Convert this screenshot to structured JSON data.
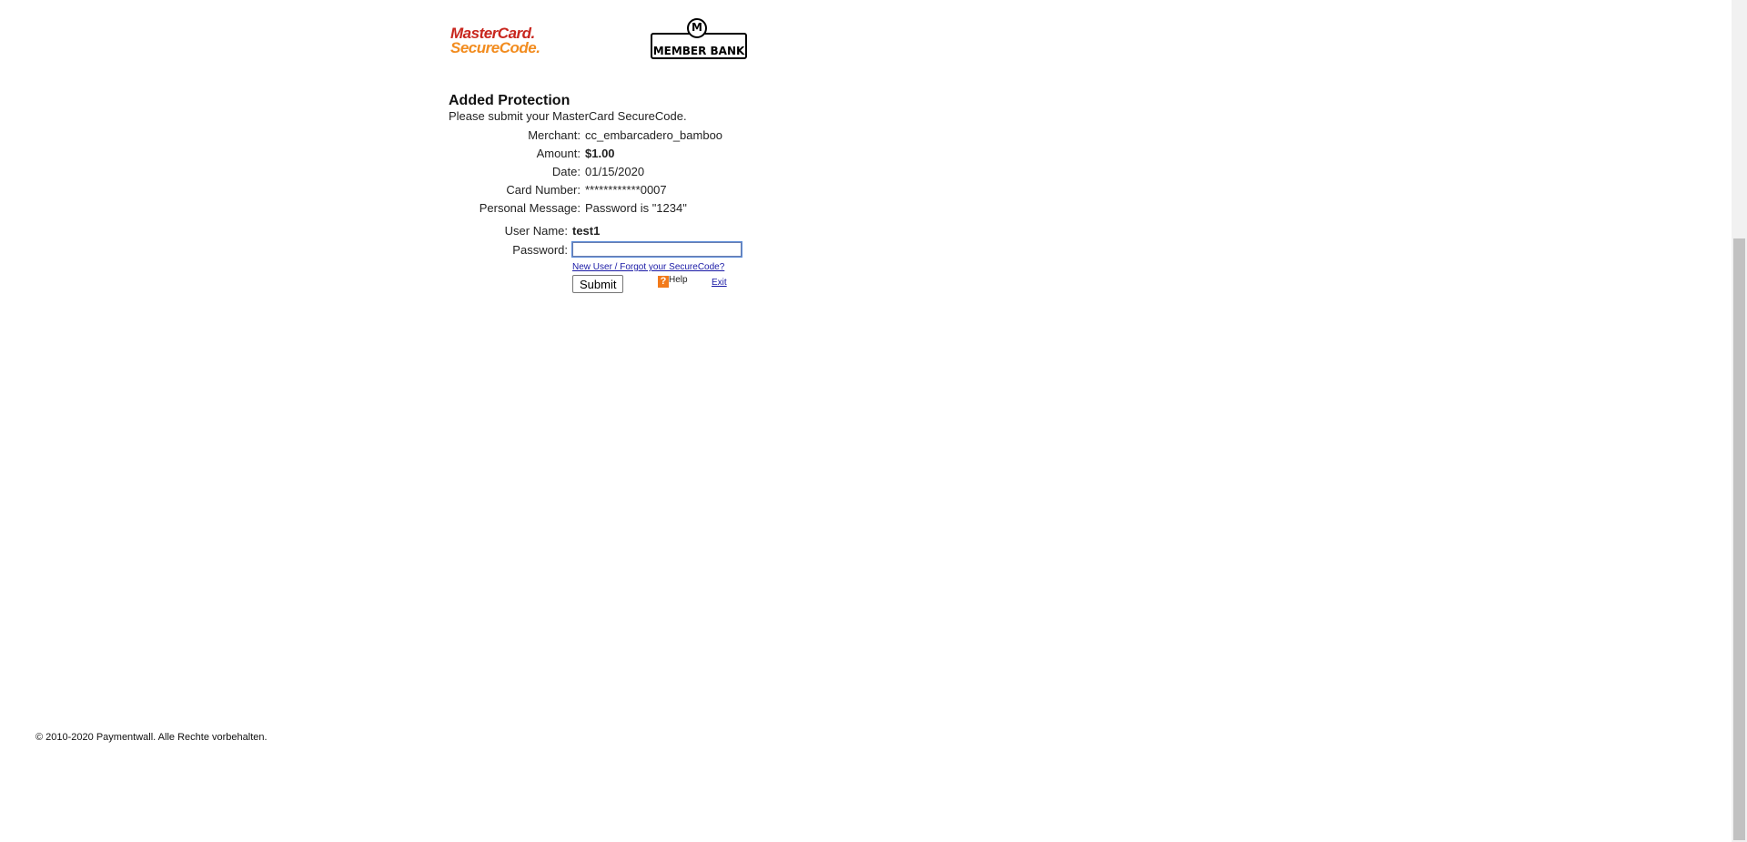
{
  "logos": {
    "mastercard_line1": "MasterCard.",
    "mastercard_line2": "SecureCode.",
    "bank_mark": "M",
    "bank_name": "MEMBER BANK"
  },
  "header": {
    "title": "Added Protection",
    "instruction": "Please submit your MasterCard SecureCode."
  },
  "details": [
    {
      "label": "Merchant:",
      "value": "cc_embarcadero_bamboo"
    },
    {
      "label": "Amount:",
      "value": "$1.00"
    },
    {
      "label": "Date:",
      "value": "01/15/2020"
    },
    {
      "label": "Card Number:",
      "value": "************0007"
    },
    {
      "label": "Personal Message:",
      "value": "Password is \"1234\""
    }
  ],
  "login": {
    "username_label": "User Name:",
    "username_value": "test1",
    "password_label": "Password:",
    "password_value": "",
    "forgot_link": "New User / Forgot your SecureCode?",
    "submit_label": "Submit",
    "help_icon_glyph": "?",
    "help_label": "Help",
    "exit_label": "Exit"
  },
  "footer": {
    "copyright": "© 2010-2020 Paymentwall. Alle Rechte vorbehalten."
  },
  "colors": {
    "mastercard_red": "#c8261e",
    "mastercard_orange": "#f28c1f",
    "link_blue": "#1a1aa6",
    "help_orange": "#f27a1a"
  }
}
